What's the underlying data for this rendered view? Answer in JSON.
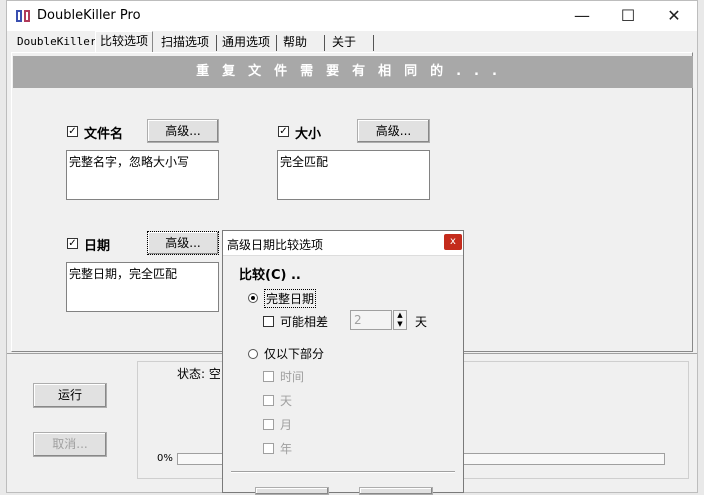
{
  "window": {
    "title": "DoubleKiller Pro",
    "controls": {
      "minimize": "—",
      "maximize": "☐",
      "close": "✕"
    }
  },
  "tabs": [
    "DoubleKiller",
    "比较选项",
    "扫描选项",
    "通用选项",
    "帮助",
    "关于"
  ],
  "active_tab": "比较选项",
  "banner": "重复文件需要有相同的...",
  "filename": {
    "label": "文件名",
    "checked": true,
    "advanced": "高级...",
    "summary": "完整名字，忽略大小写"
  },
  "size": {
    "label": "大小",
    "checked": true,
    "advanced": "高级...",
    "summary": "完全匹配"
  },
  "date": {
    "label": "日期",
    "checked": true,
    "advanced": "高级...",
    "summary": "完整日期，完全匹配"
  },
  "actions": {
    "run": "运行",
    "cancel": "取消..."
  },
  "status": {
    "label": "状态: 空",
    "progress_text": "0%",
    "progress": 0
  },
  "dialog": {
    "title": "高级日期比较选项",
    "close": "x",
    "compare_label": "比较(C) ..",
    "full_date": {
      "label": "完整日期",
      "selected": true
    },
    "may_differ": {
      "label": "可能相差",
      "checked": false,
      "value": "2",
      "unit": "天"
    },
    "partial": {
      "label": "仅以下部分",
      "selected": false
    },
    "parts": [
      "时间",
      "天",
      "月",
      "年"
    ]
  },
  "colors": {
    "banner_bg": "#a8a8a8",
    "close_red": "#c42b1c"
  }
}
